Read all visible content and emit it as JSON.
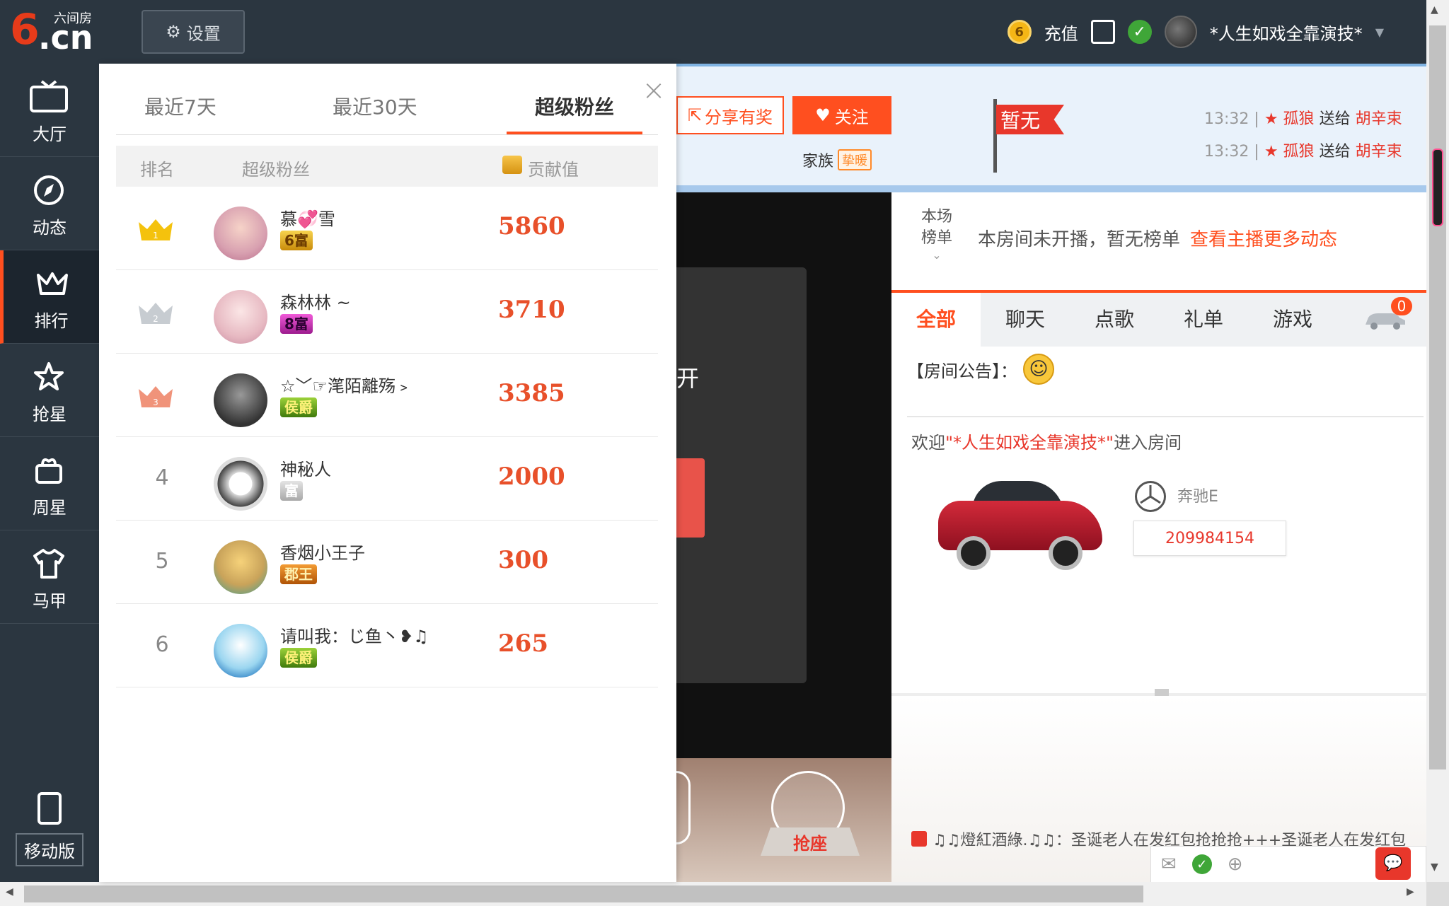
{
  "topbar": {
    "logo_six": "6",
    "logo_cn": ".cn",
    "logo_small": "六间房",
    "settings_label": "设置",
    "coin_label": "6",
    "recharge_label": "充值",
    "username": "*人生如戏全靠演技*"
  },
  "sidebar": {
    "items": [
      {
        "label": "大厅",
        "icon": "tv-icon"
      },
      {
        "label": "动态",
        "icon": "compass-icon"
      },
      {
        "label": "排行",
        "icon": "crown-icon"
      },
      {
        "label": "抢星",
        "icon": "star-icon"
      },
      {
        "label": "周星",
        "icon": "gift-basket-icon"
      },
      {
        "label": "马甲",
        "icon": "shirt-icon"
      }
    ],
    "active_index": 2,
    "mobile_label": "移动版"
  },
  "room": {
    "share_label": "分享有奖",
    "follow_label": "关注",
    "family_label": "家族",
    "family_tag": "挚暖",
    "flag_text": "暂无",
    "gift_messages": [
      {
        "time": "13:32",
        "sender": "孤狼",
        "action": "送给",
        "receiver": "胡辛束"
      },
      {
        "time": "13:32",
        "sender": "孤狼",
        "action": "送给",
        "receiver": "胡辛束"
      }
    ],
    "video_text": "开",
    "seat_button": "抢座",
    "rank_label_line1": "本场",
    "rank_label_line2": "榜单",
    "rank_message": "本房间未开播，暂无榜单",
    "rank_link": "查看主播更多动态",
    "chat_tabs": [
      "全部",
      "聊天",
      "点歌",
      "礼单",
      "游戏"
    ],
    "car_badge": "0",
    "notice_label": "【房间公告】：",
    "welcome_prefix": "欢迎",
    "welcome_name": "\"*人生如戏全靠演技*\"",
    "welcome_suffix": "进入房间",
    "car_name": "奔驰E",
    "car_number": "209984154",
    "ticker": "♫♫燈紅酒綠.♫♫：圣诞老人在发红包抢抢抢+++圣诞老人在发红包"
  },
  "popup": {
    "tabs": [
      "最近7天",
      "最近30天",
      "超级粉丝"
    ],
    "active_tab": 2,
    "headers": {
      "rank": "排名",
      "fan": "超级粉丝",
      "contribution": "贡献值"
    },
    "rows": [
      {
        "rank": "1",
        "name": "慕💞雪",
        "badge": "6富",
        "score": "5860"
      },
      {
        "rank": "2",
        "name": "森林林 ~",
        "badge": "8富",
        "score": "3710"
      },
      {
        "rank": "3",
        "name": "☆﹀☞滗陌離殇﹥",
        "badge": "侯爵",
        "score": "3385"
      },
      {
        "rank": "4",
        "name": "神秘人",
        "badge": "富",
        "score": "2000"
      },
      {
        "rank": "5",
        "name": "香烟小王子",
        "badge": "郡王",
        "score": "300"
      },
      {
        "rank": "6",
        "name": "请叫我：じ鱼丶❥♫",
        "badge": "侯爵",
        "score": "265"
      }
    ]
  },
  "colors": {
    "accent": "#ff4f1f",
    "sidebar_bg": "#2b3640",
    "score": "#e8502a"
  }
}
